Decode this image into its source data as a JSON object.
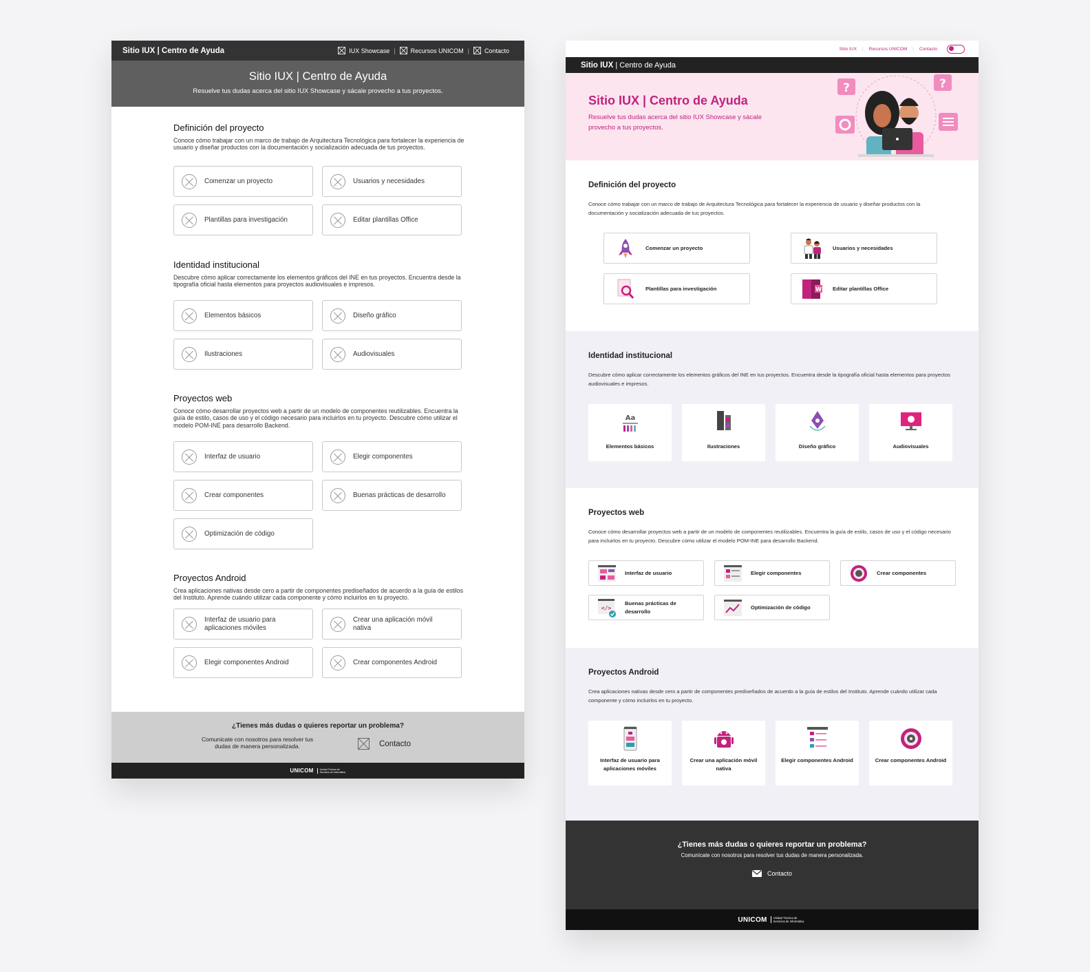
{
  "wireframe": {
    "brand": "Sitio IUX | Centro de Ayuda",
    "nav": [
      {
        "label": "IUX Showcase",
        "icon": "placeholder-icon"
      },
      {
        "label": "Recursos UNICOM",
        "icon": "placeholder-icon"
      },
      {
        "label": "Contacto",
        "icon": "placeholder-icon"
      }
    ],
    "nav_separator": "|",
    "hero": {
      "title": "Sitio IUX | Centro de Ayuda",
      "subtitle": "Resuelve tus dudas acerca del sitio IUX Showcase y sácale provecho a tus proyectos."
    },
    "sections": [
      {
        "title": "Definición del proyecto",
        "desc": "Conoce cómo trabajar con un marco de trabajo de Arquitectura Tecnológica para fortalecer la experiencia de usuario y diseñar productos con la documentación y socialización adecuada de tus proyectos.",
        "items": [
          "Comenzar un proyecto",
          "Usuarios y necesidades",
          "Plantillas para investigación",
          "Editar plantillas Office"
        ]
      },
      {
        "title": "Identidad institucional",
        "desc": "Descubre cómo aplicar correctamente los elementos gráficos del INE en tus proyectos. Encuentra desde la tipografía oficial hasta elementos para proyectos audiovisuales e impresos.",
        "items": [
          "Elementos básicos",
          "Diseño gráfico",
          "Ilustraciones",
          "Audiovisuales"
        ]
      },
      {
        "title": "Proyectos web",
        "desc": "Conoce cómo desarrollar proyectos web a partir de un modelo de componentes reutilizables. Encuentra la guía de estilo, casos de uso y el código necesario para incluirlos en tu proyecto. Descubre cómo utilizar el modelo POM-INE para desarrollo Backend.",
        "items": [
          "Interfaz de usuario",
          "Elegir componentes",
          "Crear componentes",
          "Buenas prácticas de desarrollo",
          "Optimización de código"
        ]
      },
      {
        "title": "Proyectos Android",
        "desc": "Crea aplicaciones nativas desde cero a partir de componentes prediseñados de acuerdo a la guía de estilos del Instituto. Aprende cuándo utilizar cada componente y cómo incluirlos en tu proyecto.",
        "items": [
          "Interfaz de usuario para aplicaciones móviles",
          "Crear una aplicación móvil nativa",
          "Elegir componentes Android",
          "Crear componentes Android"
        ]
      }
    ],
    "footer": {
      "title": "¿Tienes más dudas o quieres reportar un problema?",
      "text": "Comunicate con nosotros para resolver tus dudas de manera personalizada.",
      "contact": "Contacto"
    },
    "logo": {
      "name": "UNICOM",
      "sub": "Unidad Técnica de Servicios de Informática"
    }
  },
  "hifi": {
    "util_links": [
      "Sitio IUX",
      "Recursos UNICOM",
      "Contacto"
    ],
    "topbar_brand": "Sitio IUX",
    "topbar_sub": "| Centro de Ayuda",
    "hero": {
      "title": "Sitio IUX | Centro de Ayuda",
      "subtitle": "Resuelve tus dudas acerca del sitio IUX Showcase y sácale provecho a tus proyectos."
    },
    "sections": [
      {
        "title": "Definición del proyecto",
        "desc": "Conoce cómo trabajar con un marco de trabajo de Arquitectura Tecnológica para fortalecer la experiencia de usuario y diseñar productos con la documentación y socialización adecuada de tus proyectos.",
        "items": [
          {
            "label": "Comenzar un proyecto",
            "icon": "rocket-icon"
          },
          {
            "label": "Usuarios y necesidades",
            "icon": "users-icon"
          },
          {
            "label": "Plantillas para investigación",
            "icon": "magnifier-document-icon"
          },
          {
            "label": "Editar plantillas Office",
            "icon": "office-word-icon"
          }
        ]
      },
      {
        "title": "Identidad institucional",
        "desc": "Descubre cómo aplicar correctamente los elementos gráficos del INE en tus proyectos. Encuentra desde la tipografía oficial hasta elementos para proyectos audiovisuales e impresos.",
        "items": [
          {
            "label": "Elementos básicos",
            "icon": "typography-swatch-icon",
            "glyph": "Aa"
          },
          {
            "label": "Ilustraciones",
            "icon": "paint-tools-icon"
          },
          {
            "label": "Diseño gráfico",
            "icon": "pen-nib-icon"
          },
          {
            "label": "Audiovisuales",
            "icon": "monitor-play-icon"
          }
        ]
      },
      {
        "title": "Proyectos web",
        "desc": "Conoce cómo desarrollar proyectos web a partir de un modelo de componentes reutilizables. Encuentra la guía de estilo, casos de uso y el código necesario para incluirlos en tu proyecto. Descubre cómo utilizar el modelo POM-INE para desarrollo Backend.",
        "items": [
          {
            "label": "Interfaz de usuario",
            "icon": "ui-layout-icon"
          },
          {
            "label": "Elegir componentes",
            "icon": "components-list-icon"
          },
          {
            "label": "Crear componentes",
            "icon": "gear-component-icon"
          },
          {
            "label": "Buenas prácticas de desarrollo",
            "icon": "code-check-icon"
          },
          {
            "label": "Optimización de código",
            "icon": "chart-browser-icon"
          }
        ]
      },
      {
        "title": "Proyectos Android",
        "desc": "Crea aplicaciones nativas desde cero a partir de componentes prediseñados de acuerdo a la guía de estilos del Instituto. Aprende cuándo utilizar cada componente y cómo incluirlos en tu proyecto.",
        "items": [
          {
            "label": "Interfaz de usuario para aplicaciones móviles",
            "icon": "mobile-ui-icon"
          },
          {
            "label": "Crear una aplicación móvil nativa",
            "icon": "android-gear-icon"
          },
          {
            "label": "Elegir componentes Android",
            "icon": "android-list-icon"
          },
          {
            "label": "Crear componentes Android",
            "icon": "android-component-icon"
          }
        ]
      }
    ],
    "footer": {
      "title": "¿Tienes más dudas o quieres reportar un problema?",
      "text": "Comunícate con nosotros para resolver tus dudas de manera personalizada.",
      "contact": "Contacto",
      "contact_icon": "envelope-icon"
    },
    "logo": {
      "name": "UNICOM",
      "sub": "Unidad Técnica de Servicios de Informática"
    }
  },
  "colors": {
    "accent": "#c0237d",
    "hero_bg": "#fce5ef",
    "section_alt_bg": "#f2f0f7",
    "dark": "#333333",
    "wire_hero": "#5f5f5f"
  }
}
